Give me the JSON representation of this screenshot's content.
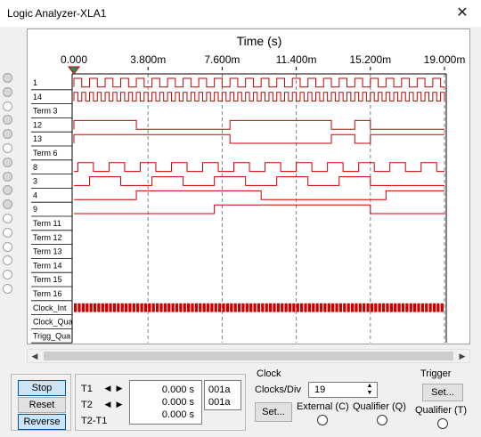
{
  "window": {
    "title": "Logic Analyzer-XLA1",
    "close_glyph": "✕"
  },
  "axis": {
    "title": "Time (s)",
    "ticks": [
      "0.000",
      "3.800m",
      "7.600m",
      "11.400m",
      "15.200m",
      "19.000m"
    ]
  },
  "channels": [
    "1",
    "14",
    "Term 3",
    "12",
    "13",
    "Term 6",
    "8",
    "3",
    "4",
    "9",
    "Term 11",
    "Term 12",
    "Term 13",
    "Term 14",
    "Term 15",
    "Term 16",
    "Clock_Int",
    "Clock_Qua",
    "Trigg_Qua"
  ],
  "side_circles_filled": [
    true,
    true,
    false,
    true,
    true,
    false,
    true,
    true,
    true,
    true,
    false,
    false,
    false,
    false,
    false,
    false
  ],
  "waveforms": {
    "1": {
      "period": 4,
      "duty": 0.5
    },
    "14": {
      "period": 2,
      "duty": 0.5
    },
    "12": {
      "toggles": [
        0,
        16,
        40,
        66,
        72,
        76
      ]
    },
    "13": {
      "toggles": [
        0,
        40,
        66,
        72,
        76
      ]
    },
    "8": {
      "period": 8,
      "duty": 0.5,
      "start": 1
    },
    "3": {
      "toggles": [
        4,
        12,
        20,
        28,
        36,
        44,
        52,
        60,
        68,
        76
      ]
    },
    "4": {
      "toggles": [
        16,
        48,
        80
      ]
    },
    "9": {
      "toggles": [
        36,
        76
      ]
    }
  },
  "sim": {
    "total_clocks": 95
  },
  "controls": {
    "stop": "Stop",
    "reset": "Reset",
    "reverse": "Reverse",
    "t1_label": "T1",
    "t2_label": "T2",
    "t2t1_label": "T2-T1",
    "t1_time": "0.000 s",
    "t2_time": "0.000 s",
    "t2t1_time": "0.000 s",
    "t1_hex": "001a",
    "t2_hex": "001a"
  },
  "clock": {
    "group_label": "Clock",
    "clocks_per_div_label": "Clocks/Div",
    "clocks_per_div": "19",
    "set_label": "Set...",
    "external_label": "External (C)",
    "qualifier_label": "Qualifier (Q)"
  },
  "trigger": {
    "group_label": "Trigger",
    "set_label": "Set...",
    "qualifier_label": "Qualifier (T)"
  },
  "colors": {
    "trace": "#cc0000",
    "grid": "#808080",
    "trigger_marker": "#2e8b57"
  }
}
